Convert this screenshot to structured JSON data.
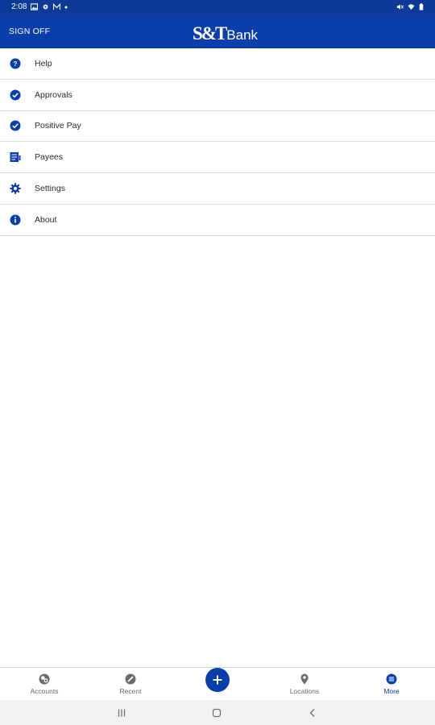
{
  "status_bar": {
    "time": "2:08",
    "left_icons": [
      "image-icon",
      "gear-icon",
      "mail-icon",
      "dot-icon"
    ],
    "right_icons": [
      "mute-icon",
      "wifi-icon",
      "battery-icon"
    ]
  },
  "header": {
    "sign_off_label": "SIGN OFF",
    "logo_mark": "S&T",
    "logo_word": "Bank",
    "brand_color": "#0b3ea8"
  },
  "menu": {
    "items": [
      {
        "label": "Help",
        "icon": "help-icon"
      },
      {
        "label": "Approvals",
        "icon": "check-circle-icon"
      },
      {
        "label": "Positive Pay",
        "icon": "check-circle-icon"
      },
      {
        "label": "Payees",
        "icon": "payees-list-icon"
      },
      {
        "label": "Settings",
        "icon": "gear-icon"
      },
      {
        "label": "About",
        "icon": "info-icon"
      }
    ]
  },
  "bottom_nav": {
    "items": [
      {
        "label": "Accounts",
        "icon": "accounts-icon"
      },
      {
        "label": "Recent",
        "icon": "recent-icon"
      },
      {
        "label": "Locations",
        "icon": "location-pin-icon"
      },
      {
        "label": "More",
        "icon": "more-icon",
        "active": true
      }
    ],
    "fab_icon": "plus-icon"
  },
  "system_nav": [
    "recents-icon",
    "home-icon",
    "back-icon"
  ]
}
